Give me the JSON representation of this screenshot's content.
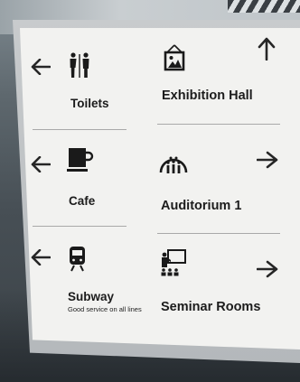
{
  "sign": {
    "left": [
      {
        "label": "Toilets",
        "icon": "toilets-icon",
        "arrow": "left"
      },
      {
        "label": "Cafe",
        "icon": "coffee-cup-icon",
        "arrow": "left"
      },
      {
        "label": "Subway",
        "sublabel": "Good service on all lines",
        "icon": "train-icon",
        "arrow": "left"
      }
    ],
    "right": [
      {
        "label": "Exhibition Hall",
        "icon": "framed-picture-icon",
        "arrow": "up"
      },
      {
        "label": "Auditorium 1",
        "icon": "audience-icon",
        "arrow": "right"
      },
      {
        "label": "Seminar Rooms",
        "icon": "presentation-icon",
        "arrow": "right"
      }
    ]
  },
  "colors": {
    "panel": "#f2f2f0",
    "ink": "#1c1c1c",
    "frame": "#bdc1c4"
  }
}
